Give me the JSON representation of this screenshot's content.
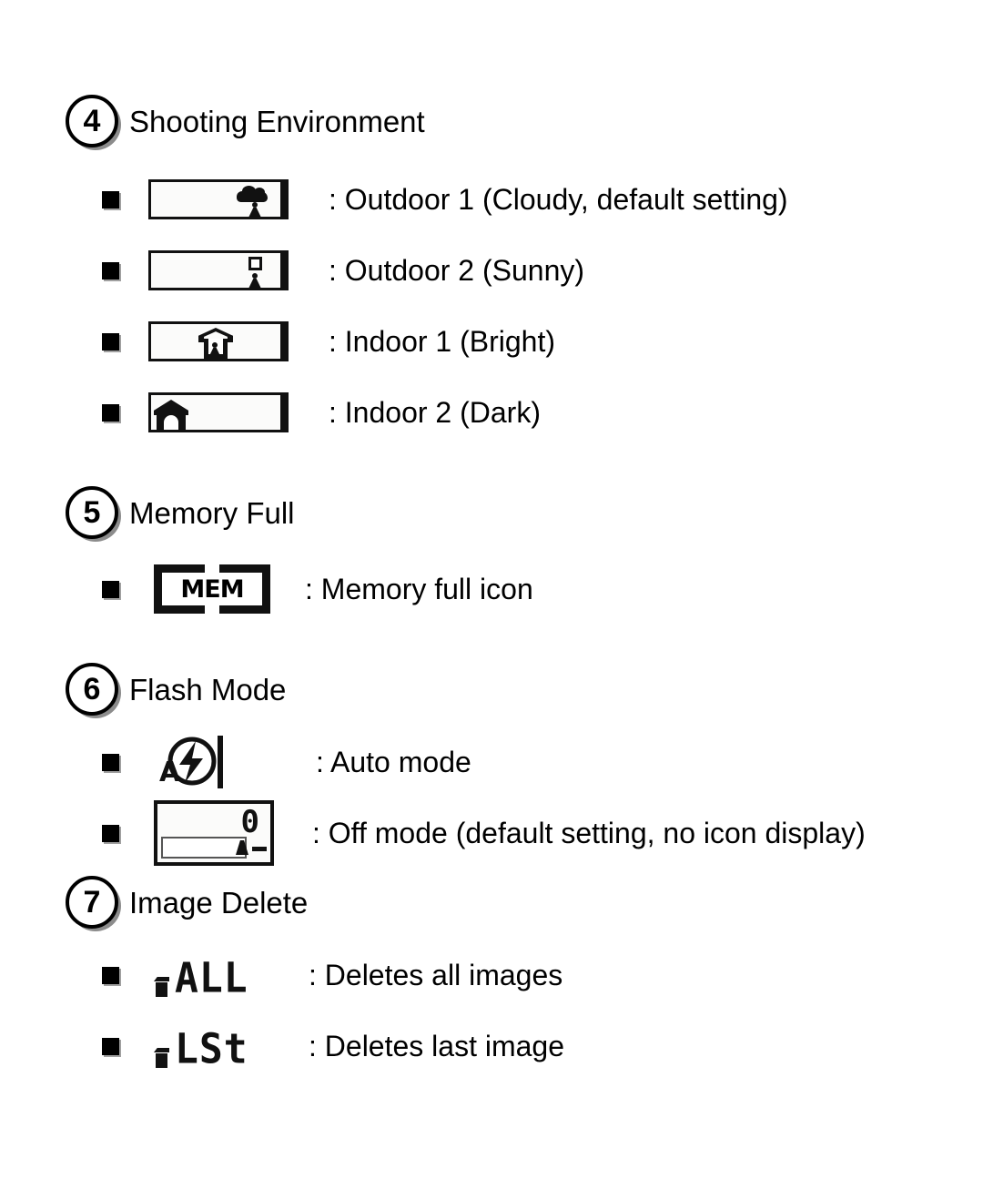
{
  "document": {
    "type": "camera-lcd-icon-guide"
  },
  "sections": [
    {
      "number": "4",
      "title": "Shooting Environment",
      "items": [
        {
          "icon": "lcd-cloud-figure-icon",
          "label": ": Outdoor 1 (Cloudy, default setting)"
        },
        {
          "icon": "lcd-sun-figure-icon",
          "label": ": Outdoor 2 (Sunny)"
        },
        {
          "icon": "lcd-house-outline-icon",
          "label": ": Indoor 1 (Bright)"
        },
        {
          "icon": "lcd-house-solid-icon",
          "label": ": Indoor 2 (Dark)"
        }
      ]
    },
    {
      "number": "5",
      "title": "Memory Full",
      "items": [
        {
          "icon": "mem-icon",
          "icon_text": "MEM",
          "label": ": Memory full icon"
        }
      ]
    },
    {
      "number": "6",
      "title": "Flash Mode",
      "items": [
        {
          "icon": "auto-flash-icon",
          "icon_text": "A",
          "label": ": Auto mode"
        },
        {
          "icon": "lcd-off-mode-icon",
          "icon_text": "0",
          "label": ": Off mode (default setting, no icon display)"
        }
      ]
    },
    {
      "number": "7",
      "title": "Image Delete",
      "items": [
        {
          "icon": "delete-all-icon",
          "icon_text": "ALL",
          "label": ": Deletes all images"
        },
        {
          "icon": "delete-last-icon",
          "icon_text": "LSt",
          "label": ": Deletes last image"
        }
      ]
    }
  ],
  "colors": {
    "ink": "#000000",
    "page": "#ffffff",
    "lcd_background": "#fbfbfa",
    "shadow": "#787878"
  }
}
